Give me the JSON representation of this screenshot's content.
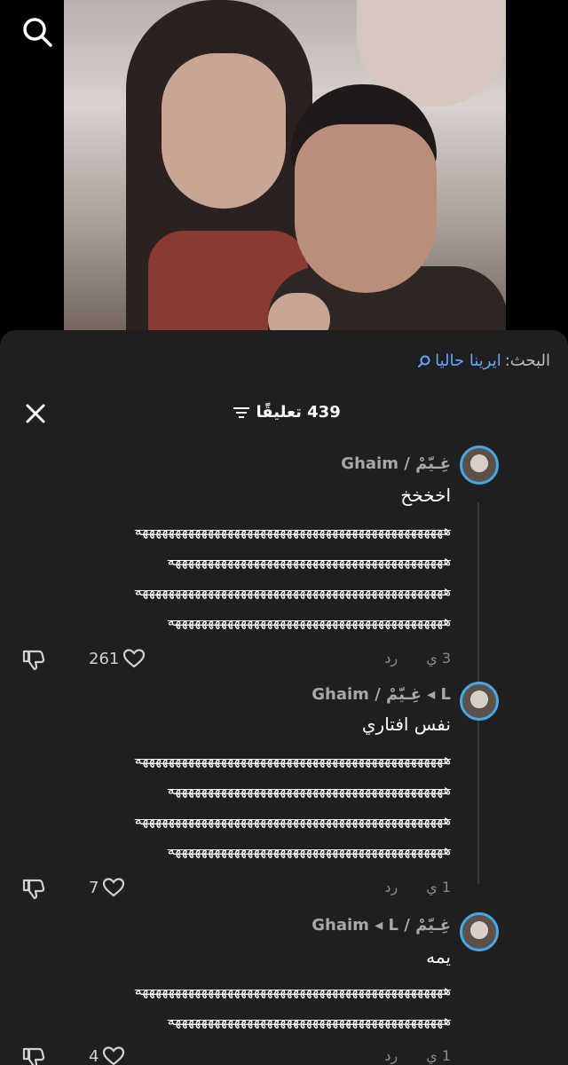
{
  "top": {
    "search_icon": "search-icon"
  },
  "sheet": {
    "search_prefix": "البحث:",
    "search_query": "ايرينا حاليا",
    "comment_count_label": "439 تعليقًا"
  },
  "comments": [
    {
      "author": "غِـيّمْ / Ghaim",
      "text": "اخخخخ",
      "laugh_lines": [
        "هههههههههههههههههههههههههههههههههههههههههههههههه",
        "ههههههههههههههههههههههههههههههههههههههههههه",
        "هههههههههههههههههههههههههههههههههههههههههههههههه",
        "ههههههههههههههههههههههههههههههههههههههههههه"
      ],
      "time": "3 ي",
      "reply_label": "رد",
      "likes": "261"
    },
    {
      "author": "L ◂ غِـيّمْ / Ghaim",
      "text": "نفس افتاري",
      "laugh_lines": [
        "هههههههههههههههههههههههههههههههههههههههههههههههه",
        "ههههههههههههههههههههههههههههههههههههههههههه",
        "هههههههههههههههههههههههههههههههههههههههههههههههه",
        "ههههههههههههههههههههههههههههههههههههههههههه"
      ],
      "time": "1 ي",
      "reply_label": "رد",
      "likes": "7"
    },
    {
      "author": "غِـيّمْ / Ghaim ◂ L",
      "text": "يمه",
      "laugh_lines": [
        "هههههههههههههههههههههههههههههههههههههههههههههههه",
        "ههههههههههههههههههههههههههههههههههههههههههه"
      ],
      "time": "1 ي",
      "reply_label": "رد",
      "likes": "4"
    }
  ],
  "colors": {
    "sheet_bg": "#1f1f1f",
    "link": "#5fa8ff",
    "avatar_ring": "#48a7e8"
  }
}
